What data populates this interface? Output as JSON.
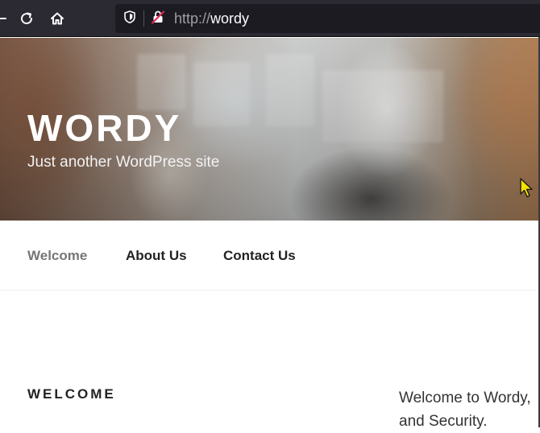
{
  "browser": {
    "url_scheme": "http://",
    "url_host": "wordy",
    "icons": {
      "back": "back-arrow-icon",
      "reload": "reload-icon",
      "home": "home-icon",
      "tracking": "shield-icon",
      "insecure": "insecure-lock-icon"
    },
    "colors": {
      "toolbar": "#2b2a33",
      "urlbar": "#1c1b22",
      "insecure_slash": "#e22850"
    }
  },
  "site": {
    "title": "WORDY",
    "tagline": "Just another WordPress site"
  },
  "nav": {
    "items": [
      {
        "label": "Welcome",
        "current": true
      },
      {
        "label": "About Us",
        "current": false
      },
      {
        "label": "Contact Us",
        "current": false
      }
    ]
  },
  "content": {
    "entry_title": "WELCOME",
    "entry_text_line1": "Welcome to Wordy,",
    "entry_text_line2": "and Security."
  },
  "cursor": {
    "icon": "arrow-pointer-icon",
    "color": "#f5e000"
  }
}
